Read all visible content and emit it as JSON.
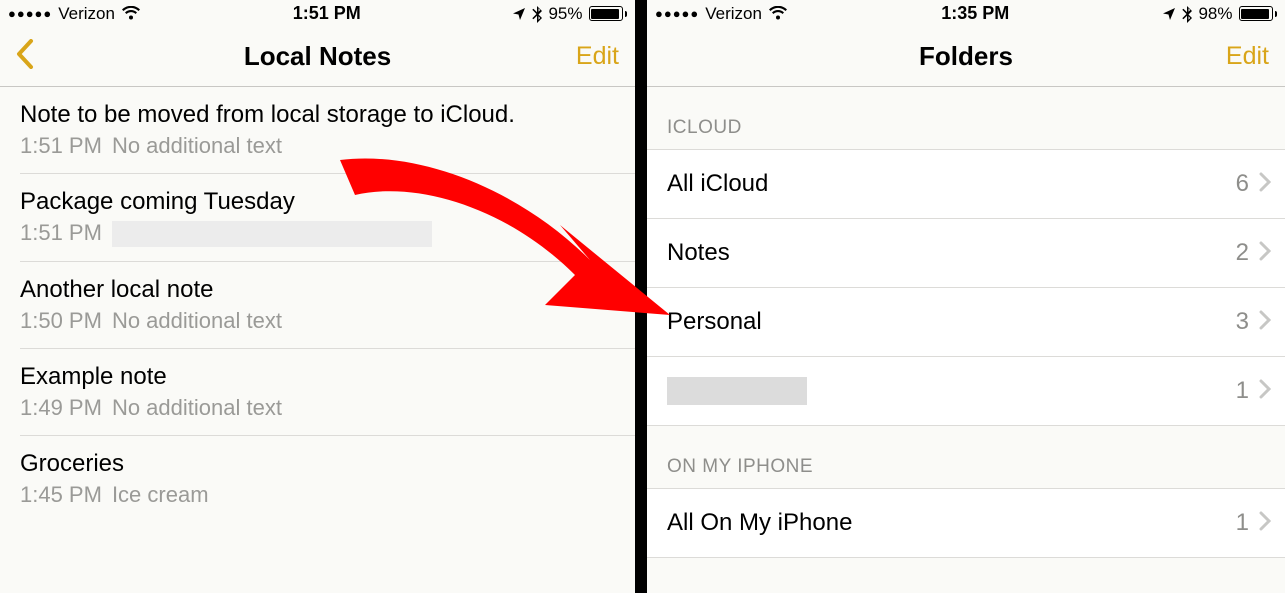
{
  "left": {
    "status": {
      "carrier": "Verizon",
      "time": "1:51 PM",
      "battery_pct": "95%",
      "battery_fill": 95
    },
    "nav": {
      "title": "Local Notes",
      "edit": "Edit"
    },
    "notes": [
      {
        "title": "Note to be moved from local storage to iCloud.",
        "time": "1:51 PM",
        "preview": "No additional text",
        "redacted": false
      },
      {
        "title": "Package coming Tuesday",
        "time": "1:51 PM",
        "preview": "",
        "redacted": true
      },
      {
        "title": "Another local note",
        "time": "1:50 PM",
        "preview": "No additional text",
        "redacted": false
      },
      {
        "title": "Example note",
        "time": "1:49 PM",
        "preview": "No additional text",
        "redacted": false
      },
      {
        "title": "Groceries",
        "time": "1:45 PM",
        "preview": "Ice cream",
        "redacted": false
      }
    ]
  },
  "right": {
    "status": {
      "carrier": "Verizon",
      "time": "1:35 PM",
      "battery_pct": "98%",
      "battery_fill": 98
    },
    "nav": {
      "title": "Folders",
      "edit": "Edit"
    },
    "sections": [
      {
        "header": "ICLOUD",
        "folders": [
          {
            "name": "All iCloud",
            "count": "6",
            "redacted": false
          },
          {
            "name": "Notes",
            "count": "2",
            "redacted": false
          },
          {
            "name": "Personal",
            "count": "3",
            "redacted": false
          },
          {
            "name": "",
            "count": "1",
            "redacted": true
          }
        ]
      },
      {
        "header": "ON MY IPHONE",
        "folders": [
          {
            "name": "All On My iPhone",
            "count": "1",
            "redacted": false
          }
        ]
      }
    ]
  }
}
